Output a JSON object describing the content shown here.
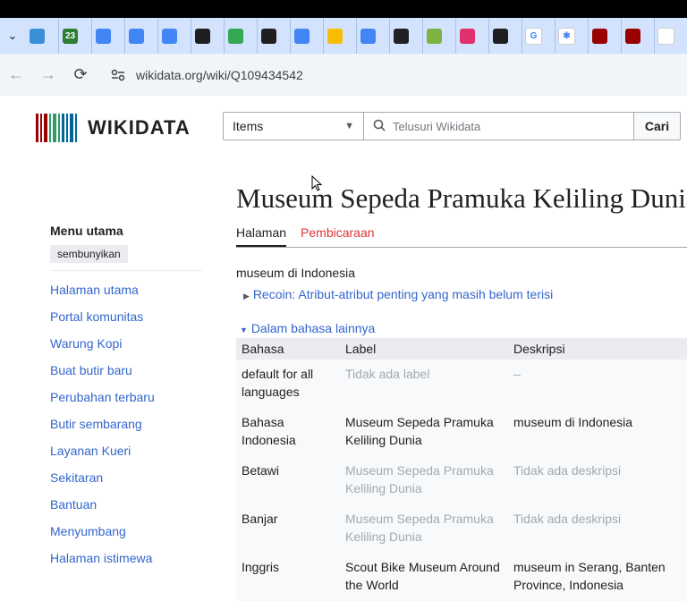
{
  "browser": {
    "url": "wikidata.org/wiki/Q109434542",
    "tabs": [
      {
        "icon": "leaf-icon",
        "color": "#3a8fd9",
        "glyph": ""
      },
      {
        "icon": "green-counter-icon",
        "color": "#2e7d32",
        "glyph": "23"
      },
      {
        "icon": "document-icon",
        "color": "#4285f4",
        "glyph": ""
      },
      {
        "icon": "docs-icon",
        "color": "#4285f4",
        "glyph": ""
      },
      {
        "icon": "docs-icon",
        "color": "#4285f4",
        "glyph": ""
      },
      {
        "icon": "wifi-icon",
        "color": "#1f1f1f",
        "glyph": ""
      },
      {
        "icon": "chrome-icon",
        "color": "#34a853",
        "glyph": ""
      },
      {
        "icon": "wifi-icon",
        "color": "#1f1f1f",
        "glyph": ""
      },
      {
        "icon": "docs-icon",
        "color": "#4285f4",
        "glyph": ""
      },
      {
        "icon": "drive-icon",
        "color": "#fbbc04",
        "glyph": ""
      },
      {
        "icon": "docs-icon",
        "color": "#4285f4",
        "glyph": ""
      },
      {
        "icon": "dark-circle-icon",
        "color": "#202124",
        "glyph": ""
      },
      {
        "icon": "yellow-app-icon",
        "color": "#7cb342",
        "glyph": ""
      },
      {
        "icon": "instagram-icon",
        "color": "#e1306c",
        "glyph": ""
      },
      {
        "icon": "wifi-icon",
        "color": "#1f1f1f",
        "glyph": ""
      },
      {
        "icon": "google-icon",
        "color": "#ffffff",
        "glyph": "G"
      },
      {
        "icon": "asterisk-icon",
        "color": "#ffffff",
        "glyph": "✱"
      },
      {
        "icon": "wikidata-icon",
        "color": "#990000",
        "glyph": ""
      },
      {
        "icon": "wikidata-icon",
        "color": "#990000",
        "glyph": ""
      },
      {
        "icon": "search-lens-icon",
        "color": "#ffffff",
        "glyph": ""
      }
    ]
  },
  "header": {
    "logo_text": "WIKIDATA",
    "search_select": "Items",
    "search_placeholder": "Telusuri Wikidata",
    "search_button": "Cari"
  },
  "sidebar": {
    "title": "Menu utama",
    "hide_label": "sembunyikan",
    "items": [
      "Halaman utama",
      "Portal komunitas",
      "Warung Kopi",
      "Buat butir baru",
      "Perubahan terbaru",
      "Butir sembarang",
      "Layanan Kueri",
      "Sekitaran",
      "Bantuan",
      "Menyumbang",
      "Halaman istimewa"
    ]
  },
  "page": {
    "title": "Museum Sepeda Pramuka Keliling Dunia",
    "tab_page": "Halaman",
    "tab_talk": "Pembicaraan",
    "description": "museum di Indonesia",
    "recoin": "Recoin: Atribut-atribut penting yang masih belum terisi",
    "other_languages": "Dalam bahasa lainnya"
  },
  "languages_table": {
    "headers": [
      "Bahasa",
      "Label",
      "Deskripsi"
    ],
    "rows": [
      {
        "lang": "default for all languages",
        "label": "Tidak ada label",
        "desc": "–",
        "muted": true
      },
      {
        "lang": "Bahasa Indonesia",
        "label": "Museum Sepeda Pramuka Keliling Dunia",
        "desc": "museum di Indonesia",
        "muted": false
      },
      {
        "lang": "Betawi",
        "label": "Museum Sepeda Pramuka Keliling Dunia",
        "desc": "Tidak ada deskripsi",
        "muted": true
      },
      {
        "lang": "Banjar",
        "label": "Museum Sepeda Pramuka Keliling Dunia",
        "desc": "Tidak ada deskripsi",
        "muted": true
      },
      {
        "lang": "Inggris",
        "label": "Scout Bike Museum Around the World",
        "desc": "museum in Serang, Banten Province, Indonesia",
        "muted": false
      }
    ]
  },
  "colors": {
    "link": "#3366cc",
    "talk": "#dd3333",
    "tabstrip": "#d3e3fd"
  }
}
